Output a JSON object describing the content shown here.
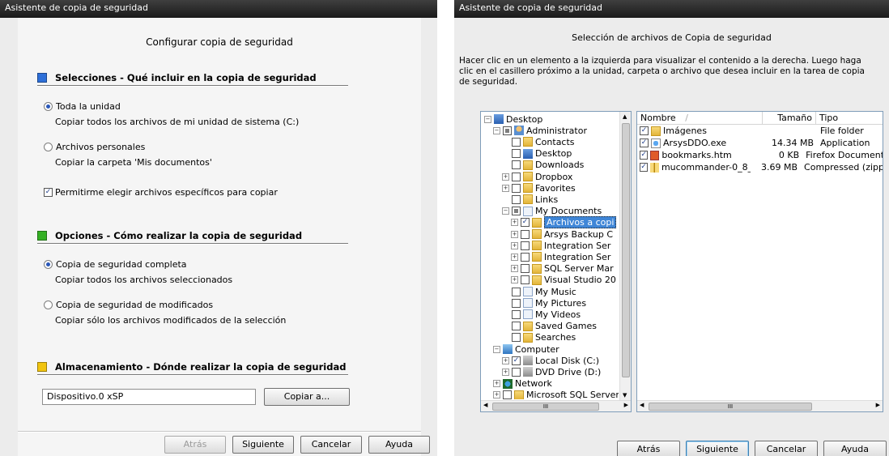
{
  "left": {
    "title": "Asistente de copia de seguridad",
    "heading": "Configurar copia de seguridad",
    "section1": {
      "title": "Selecciones - Qué incluir en la copia de seguridad",
      "opt1": "Toda la unidad",
      "opt1_desc": "Copiar todos los archivos de mi unidad de sistema (C:)",
      "opt2": "Archivos personales",
      "opt2_desc": "Copiar la carpeta 'Mis documentos'",
      "check": "Permitirme elegir archivos específicos para copiar"
    },
    "section2": {
      "title": "Opciones - Cómo realizar la copia de seguridad",
      "opt1": "Copia de seguridad completa",
      "opt1_desc": "Copiar todos los archivos seleccionados",
      "opt2": "Copia de seguridad de modificados",
      "opt2_desc": "Copiar sólo los archivos modificados de la selección"
    },
    "section3": {
      "title": "Almacenamiento - Dónde realizar la copia de seguridad",
      "device_value": "Dispositivo.0 xSP",
      "copy_button": "Copiar a..."
    },
    "buttons": {
      "back": "Atrás",
      "next": "Siguiente",
      "cancel": "Cancelar",
      "help": "Ayuda"
    },
    "colors": {
      "blue": "#2e6fd8",
      "green": "#35b024",
      "yellow": "#f1c40f"
    }
  },
  "right": {
    "title": "Asistente de copia de seguridad",
    "heading": "Selección de archivos de Copia de seguridad",
    "instructions": "Hacer clic en un elemento a la izquierda para visualizar el contenido a la derecha.  Luego haga clic en el casillero próximo a la unidad, carpeta o archivo que desea incluir en la tarea de copia de seguridad.",
    "tree": [
      {
        "label": "Desktop",
        "icon": "desk",
        "exp": "−",
        "chk": null
      },
      {
        "label": "Administrator",
        "icon": "user",
        "exp": "−",
        "chk": "partial"
      },
      {
        "label": "Contacts",
        "icon": "folder",
        "exp": "",
        "chk": "off"
      },
      {
        "label": "Desktop",
        "icon": "desk",
        "exp": "",
        "chk": "off"
      },
      {
        "label": "Downloads",
        "icon": "folder",
        "exp": "",
        "chk": "off"
      },
      {
        "label": "Dropbox",
        "icon": "folder",
        "exp": "+",
        "chk": "off"
      },
      {
        "label": "Favorites",
        "icon": "folder",
        "exp": "+",
        "chk": "off"
      },
      {
        "label": "Links",
        "icon": "folder",
        "exp": "",
        "chk": "off"
      },
      {
        "label": "My Documents",
        "icon": "doc",
        "exp": "−",
        "chk": "partial"
      },
      {
        "label": "Archivos a copi",
        "icon": "folder",
        "exp": "+",
        "chk": "on",
        "selected": true
      },
      {
        "label": "Arsys Backup C",
        "icon": "folder",
        "exp": "+",
        "chk": "off"
      },
      {
        "label": "Integration Ser",
        "icon": "folder",
        "exp": "+",
        "chk": "off"
      },
      {
        "label": "Integration Ser",
        "icon": "folder",
        "exp": "+",
        "chk": "off"
      },
      {
        "label": "SQL Server Mar",
        "icon": "folder",
        "exp": "+",
        "chk": "off"
      },
      {
        "label": "Visual Studio 20",
        "icon": "folder",
        "exp": "+",
        "chk": "off"
      },
      {
        "label": "My Music",
        "icon": "doc",
        "exp": "",
        "chk": "off"
      },
      {
        "label": "My Pictures",
        "icon": "doc",
        "exp": "",
        "chk": "off"
      },
      {
        "label": "My Videos",
        "icon": "doc",
        "exp": "",
        "chk": "off"
      },
      {
        "label": "Saved Games",
        "icon": "folder",
        "exp": "",
        "chk": "off"
      },
      {
        "label": "Searches",
        "icon": "folder",
        "exp": "",
        "chk": "off"
      },
      {
        "label": "Computer",
        "icon": "comp",
        "exp": "−",
        "chk": null
      },
      {
        "label": "Local Disk (C:)",
        "icon": "disk",
        "exp": "+",
        "chk": "on"
      },
      {
        "label": "DVD Drive (D:)",
        "icon": "disk",
        "exp": "+",
        "chk": "off"
      },
      {
        "label": "Network",
        "icon": "net",
        "exp": "+",
        "chk": null
      },
      {
        "label": "Microsoft SQL Server",
        "icon": "folder",
        "exp": "+",
        "chk": "off"
      }
    ],
    "columns": {
      "name": "Nombre",
      "sort": "/",
      "size": "Tamaño",
      "type": "Tipo"
    },
    "files": [
      {
        "name": "Imágenes",
        "icon": "folder",
        "size": "",
        "type": "File folder"
      },
      {
        "name": "ArsysDDO.exe",
        "icon": "exe",
        "size": "14.34 MB",
        "type": "Application"
      },
      {
        "name": "bookmarks.htm",
        "icon": "htm",
        "size": "0 KB",
        "type": "Firefox Document"
      },
      {
        "name": "mucommander-0_8_...",
        "icon": "zip",
        "size": "3.69 MB",
        "type": "Compressed (zipp"
      }
    ],
    "scroll_h_label": "III",
    "buttons": {
      "back": "Atrás",
      "next": "Siguiente",
      "cancel": "Cancelar",
      "help": "Ayuda"
    }
  }
}
